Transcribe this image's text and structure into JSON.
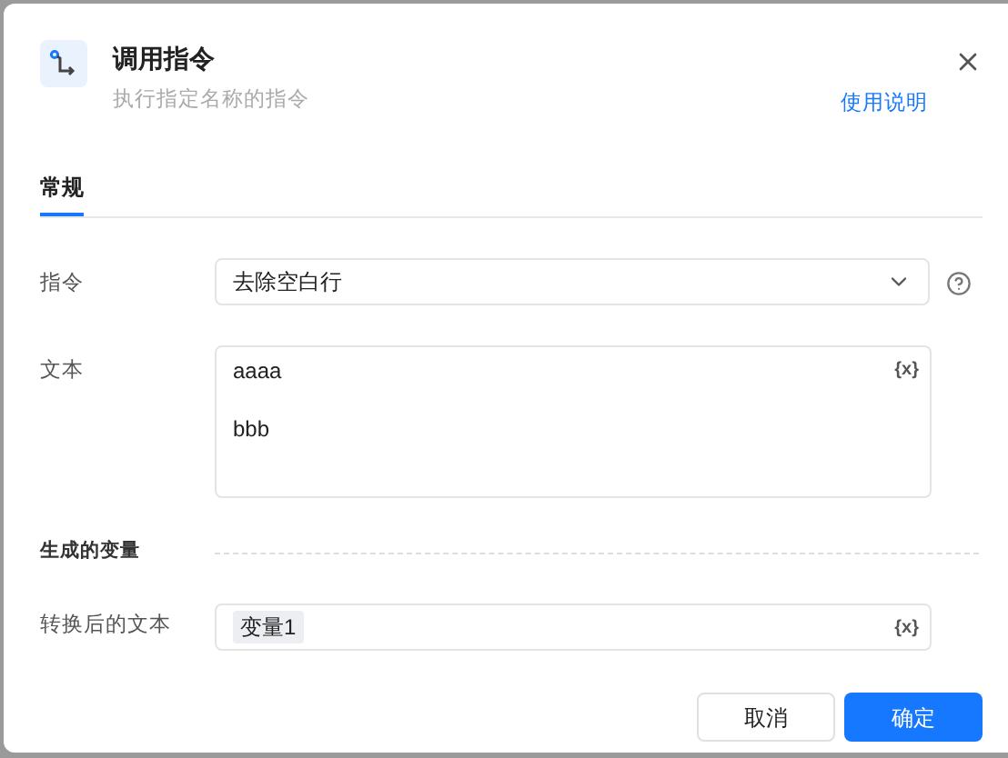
{
  "dialog": {
    "title": "调用指令",
    "subtitle": "执行指定名称的指令",
    "help_link": "使用说明"
  },
  "tabs": [
    {
      "label": "常规",
      "selected": true
    }
  ],
  "fields": [
    {
      "kind": "select",
      "label": "指令",
      "value": "去除空白行"
    },
    {
      "kind": "textarea",
      "label": "文本",
      "value": "aaaa\n\nbbb",
      "variable_button": "{x}"
    }
  ],
  "section": {
    "title": "生成的变量"
  },
  "outputs": [
    {
      "label": "转换后的文本",
      "tag": "变量1",
      "variable_button": "{x}"
    }
  ],
  "buttons": [
    {
      "label": "取消",
      "kind": "secondary"
    },
    {
      "label": "确定",
      "kind": "primary"
    }
  ]
}
